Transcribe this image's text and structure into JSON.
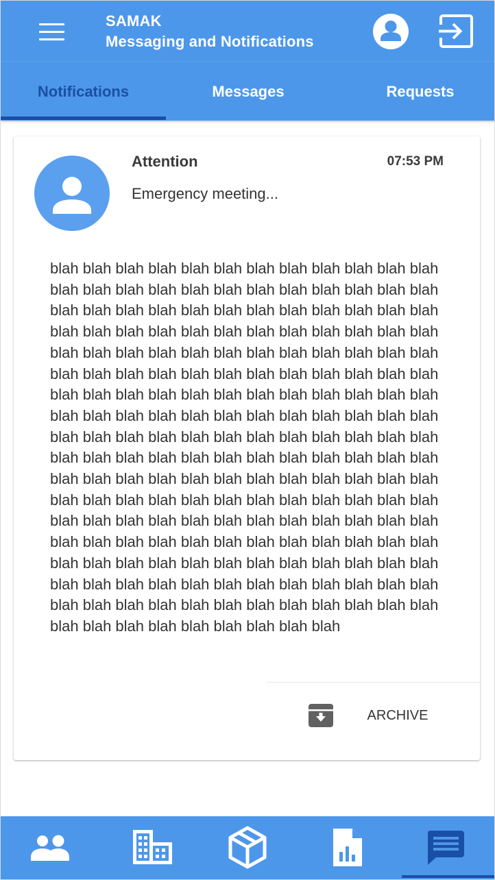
{
  "header": {
    "app_name": "SAMAK",
    "subtitle": "Messaging and Notifications",
    "menu_icon": "hamburger-menu-icon",
    "account_icon": "account-circle-icon",
    "logout_icon": "exit-to-app-icon",
    "color": "#4d97ea"
  },
  "tabs": [
    {
      "label": "Notifications",
      "active": true
    },
    {
      "label": "Messages",
      "active": false
    },
    {
      "label": "Requests",
      "active": false
    }
  ],
  "notification": {
    "title": "Attention",
    "time": "07:53 PM",
    "preview": "Emergency meeting...",
    "avatar_icon": "person-icon",
    "body": "blah blah blah blah blah blah blah blah blah blah blah blah blah blah blah blah blah blah blah blah blah blah blah blah blah blah blah blah blah blah blah blah blah blah blah blah blah blah blah blah blah blah blah blah blah blah blah blah blah blah blah blah blah blah blah blah blah blah blah blah blah blah blah blah blah blah blah blah blah blah blah blah blah blah blah blah blah blah blah blah blah blah blah blah blah blah blah blah blah blah blah blah blah blah blah blah blah blah blah blah blah blah blah blah blah blah blah blah blah blah blah blah blah blah blah blah blah blah blah blah blah blah blah blah blah blah blah blah blah blah blah blah blah blah blah blah blah blah blah blah blah blah blah blah blah blah blah blah blah blah blah blah blah blah blah blah blah blah blah blah blah blah blah blah blah blah blah blah blah blah blah blah blah blah blah blah blah blah blah blah blah blah blah blah blah blah blah blah blah blah blah blah blah blah blah blah blah blah blah blah blah blah blah blah blah blah blah blah blah blah blah blah blah",
    "archive_label": "ARCHIVE",
    "archive_icon": "archive-icon"
  },
  "bottom_nav": [
    {
      "icon": "people-icon",
      "active": false
    },
    {
      "icon": "building-icon",
      "active": false
    },
    {
      "icon": "package-box-icon",
      "active": false
    },
    {
      "icon": "report-chart-icon",
      "active": false
    },
    {
      "icon": "message-icon",
      "active": true
    }
  ],
  "colors": {
    "primary": "#4d97ea",
    "active_tab": "#1a4fa8",
    "avatar": "#5aa0ee"
  }
}
